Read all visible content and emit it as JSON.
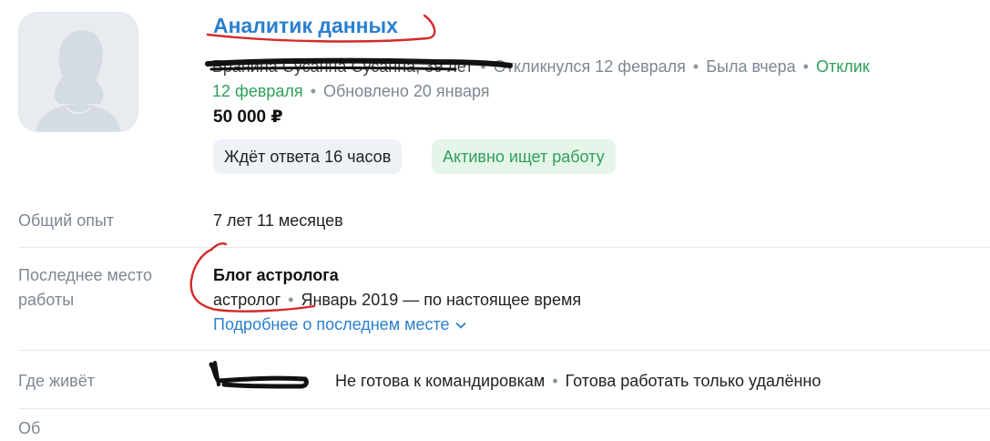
{
  "vacancy": {
    "title": "Аналитик данных"
  },
  "candidate": {
    "name_age": "Бранина Сусанна Сусанна, 39 лет",
    "responded": "Откликнулся 12 февраля",
    "last_seen": "Была вчера",
    "response_prefix": "Отклик",
    "response_date": "12 февраля",
    "updated": "Обновлено 20 января",
    "salary": "50 000 ₽",
    "tag_waiting": "Ждёт ответа 16 часов",
    "tag_status": "Активно ищет работу"
  },
  "details": {
    "experience_label": "Общий опыт",
    "experience_value": "7 лет 11 месяцев",
    "last_job_label_1": "Последнее место",
    "last_job_label_2": "работы",
    "company": "Блог астролога",
    "position": "астролог",
    "period": "Январь 2019 — по настоящее время",
    "more_link": "Подробнее о последнем месте",
    "location_label": "Где живёт",
    "trips": "Не готова к командировкам",
    "remote": "Готова работать только удалённо"
  },
  "colors": {
    "link": "#2a7fcf",
    "green": "#2fa05a",
    "muted": "#7b8793",
    "annotation": "#d42a2a"
  },
  "icons": {
    "avatar": "person-silhouette-icon",
    "expand": "chevron-down-icon"
  }
}
